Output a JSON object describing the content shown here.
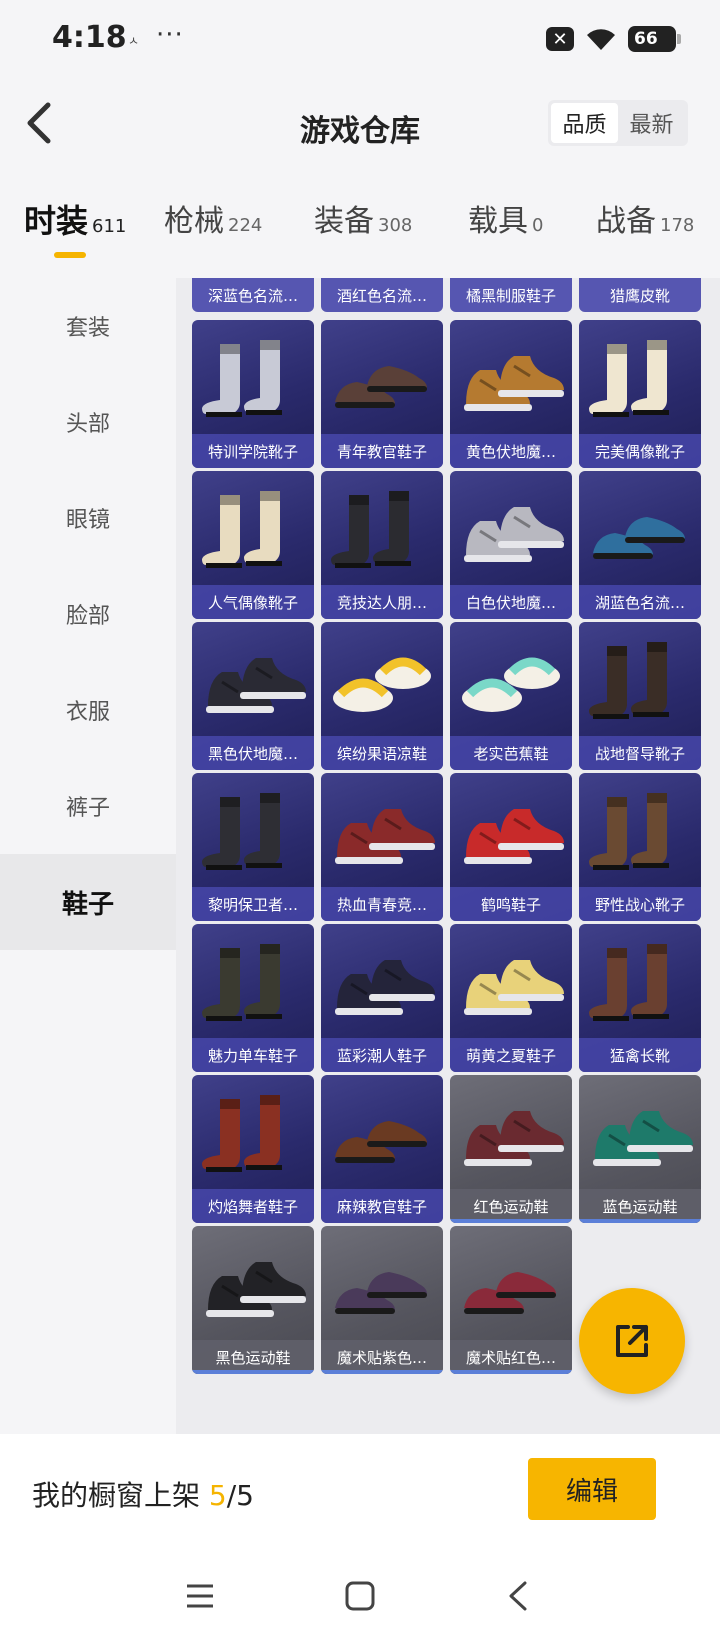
{
  "status": {
    "time": "4:18",
    "small_icon": "ㅅ",
    "dots": "···",
    "sim_icon": "✕",
    "battery": "66"
  },
  "header": {
    "title": "游戏仓库",
    "sort": [
      "品质",
      "最新"
    ]
  },
  "tabs": [
    {
      "label": "时装",
      "count": "611"
    },
    {
      "label": "枪械",
      "count": "224"
    },
    {
      "label": "装备",
      "count": "308"
    },
    {
      "label": "载具",
      "count": "0"
    },
    {
      "label": "战备",
      "count": "178"
    }
  ],
  "sidebar": [
    "套装",
    "头部",
    "眼镜",
    "脸部",
    "衣服",
    "裤子",
    "鞋子"
  ],
  "top_row": [
    "深蓝色名流…",
    "酒红色名流…",
    "橘黑制服鞋子",
    "猎鹰皮靴"
  ],
  "items": [
    {
      "name": "特训学院靴子",
      "color": "#c8cad6",
      "style": "boot"
    },
    {
      "name": "青年教官鞋子",
      "color": "#5a4038",
      "style": "shoe"
    },
    {
      "name": "黄色伏地魔…",
      "color": "#b57a30",
      "style": "sneaker"
    },
    {
      "name": "完美偶像靴子",
      "color": "#efe6d0",
      "style": "boot"
    },
    {
      "name": "人气偶像靴子",
      "color": "#e8dcc0",
      "style": "boot"
    },
    {
      "name": "竞技达人朋…",
      "color": "#2b2b30",
      "style": "boot"
    },
    {
      "name": "白色伏地魔…",
      "color": "#b8b8c0",
      "style": "sneaker"
    },
    {
      "name": "湖蓝色名流…",
      "color": "#2f6f9e",
      "style": "shoe"
    },
    {
      "name": "黑色伏地魔…",
      "color": "#2a2a34",
      "style": "sneaker"
    },
    {
      "name": "缤纷果语凉鞋",
      "color": "#f2c22a",
      "style": "sandal"
    },
    {
      "name": "老实芭蕉鞋",
      "color": "#7ad8c8",
      "style": "sandal"
    },
    {
      "name": "战地督导靴子",
      "color": "#3a2d26",
      "style": "boot"
    },
    {
      "name": "黎明保卫者…",
      "color": "#2e2e34",
      "style": "boot"
    },
    {
      "name": "热血青春竞…",
      "color": "#8a2a2a",
      "style": "sneaker"
    },
    {
      "name": "鹤鸣鞋子",
      "color": "#c82a2a",
      "style": "sneaker"
    },
    {
      "name": "野性战心靴子",
      "color": "#6a4a32",
      "style": "boot"
    },
    {
      "name": "魅力单车鞋子",
      "color": "#3a3a30",
      "style": "boot"
    },
    {
      "name": "蓝彩潮人鞋子",
      "color": "#24243a",
      "style": "sneaker"
    },
    {
      "name": "萌黄之夏鞋子",
      "color": "#e8d27a",
      "style": "sneaker"
    },
    {
      "name": "猛禽长靴",
      "color": "#6a4030",
      "style": "boot"
    },
    {
      "name": "灼焰舞者鞋子",
      "color": "#8a3022",
      "style": "boot"
    },
    {
      "name": "麻辣教官鞋子",
      "color": "#6a3a22",
      "style": "shoe"
    },
    {
      "name": "红色运动鞋",
      "color": "#6a2a30",
      "style": "sneaker"
    },
    {
      "name": "蓝色运动鞋",
      "color": "#1e7a6a",
      "style": "sneaker"
    },
    {
      "name": "黑色运动鞋",
      "color": "#222226",
      "style": "sneaker"
    },
    {
      "name": "魔术贴紫色…",
      "color": "#4a3a5a",
      "style": "shoe"
    },
    {
      "name": "魔术贴红色…",
      "color": "#8a2a3a",
      "style": "shoe"
    }
  ],
  "bottom": {
    "showcase_prefix": "我的橱窗上架 ",
    "showcase_count": "5",
    "showcase_total": "/5",
    "edit": "编辑"
  },
  "colors": {
    "accent": "#f7b500",
    "card_purple": "#2a2a6c",
    "card_grey": "#55555e"
  },
  "icons": [
    "back-arrow-icon",
    "share-icon",
    "menu-icon",
    "home-icon",
    "back-icon"
  ]
}
